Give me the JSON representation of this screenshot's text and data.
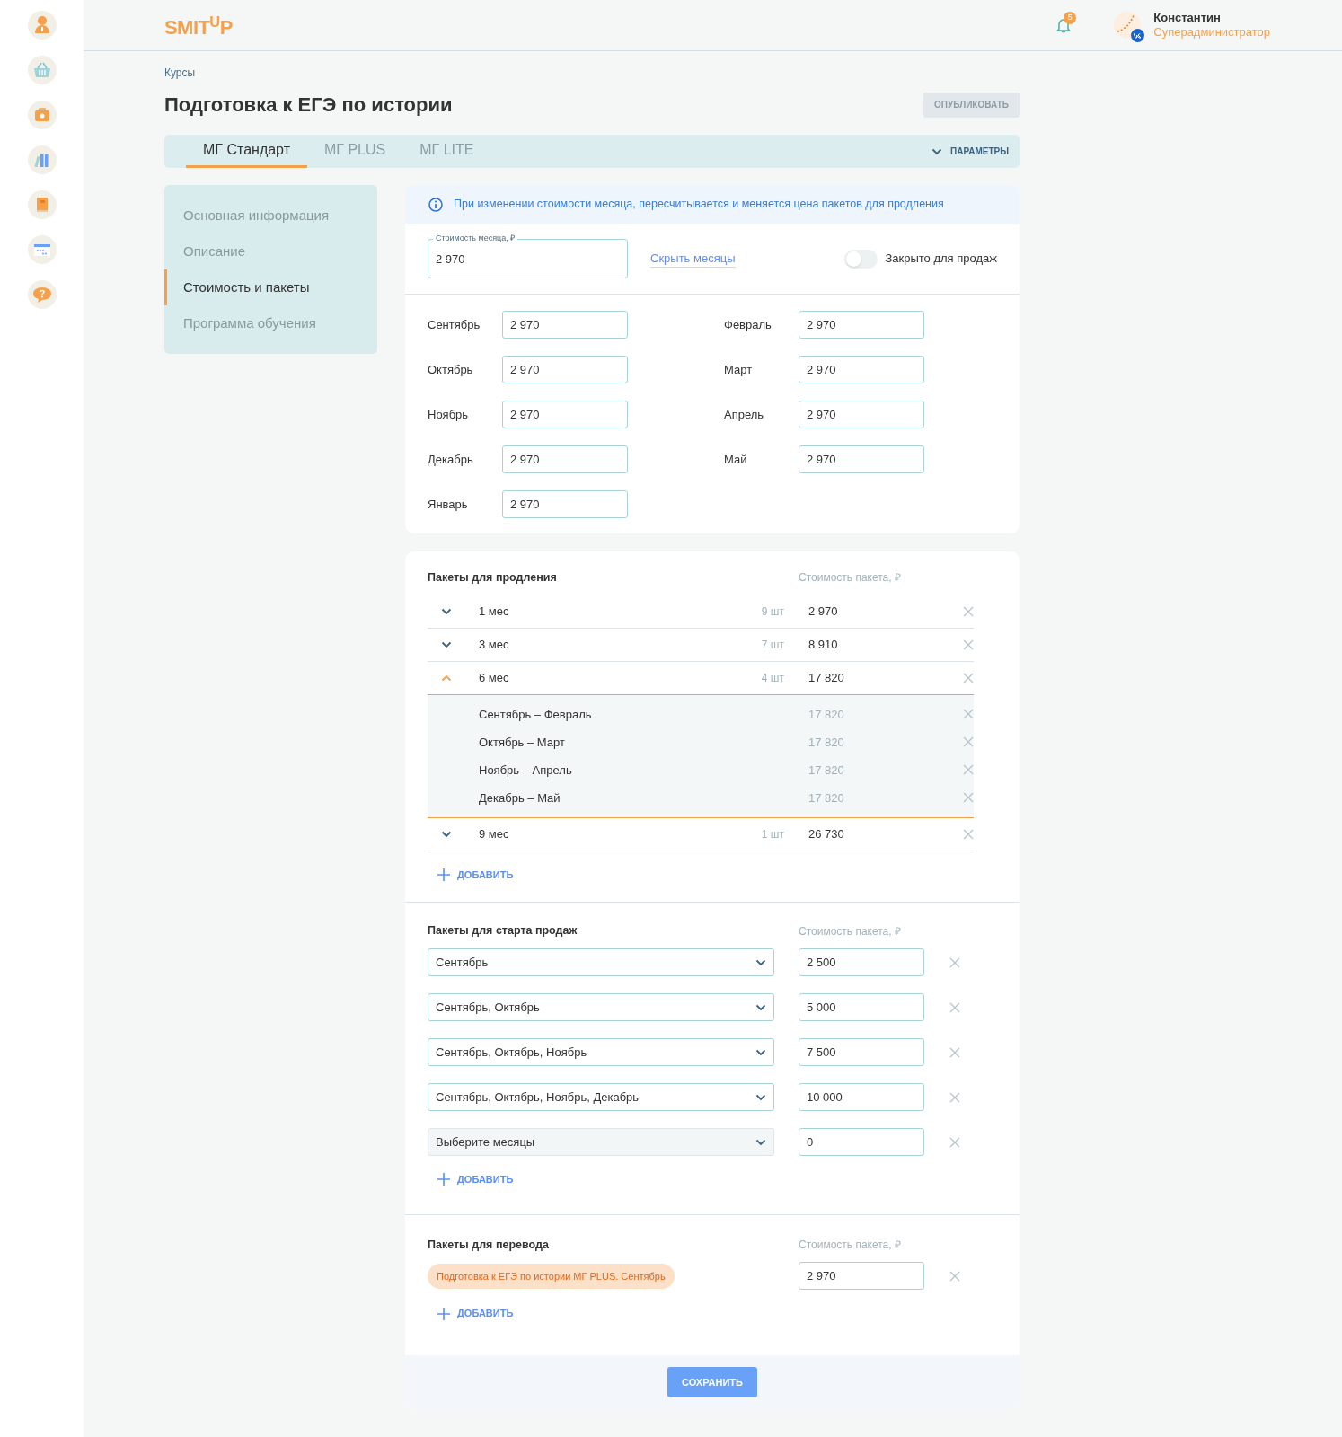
{
  "header": {
    "logo": "SMIT$^{U}$P",
    "notifications": "5",
    "user": {
      "name": "Константин",
      "role": "Суперадминистратор"
    }
  },
  "breadcrumb": "Курсы",
  "title": "Подготовка к ЕГЭ по истории",
  "publish_button": {
    "label": "ОПУБЛИКОВАТЬ",
    "disabled": true
  },
  "tabs": [
    {
      "label": "МГ Стандарт",
      "selected": true
    },
    {
      "label": "МГ PLUS",
      "selected": false
    },
    {
      "label": "МГ LITE",
      "selected": false
    }
  ],
  "params_button": "ПАРАМЕТРЫ",
  "nav": [
    {
      "label": "Основная информация",
      "selected": false
    },
    {
      "label": "Описание",
      "selected": false
    },
    {
      "label": "Стоимость и пакеты",
      "selected": true
    },
    {
      "label": "Программа обучения",
      "selected": false
    }
  ],
  "info": "При изменении стоимости месяца, пересчитывается и меняется цена пакетов для продления",
  "month_cost": {
    "label": "Стоимость месяца, ₽",
    "value": "2 970"
  },
  "hide_months_link": "Скрыть месяцы",
  "closed_toggle": {
    "label": "Закрыто для продаж",
    "on": false
  },
  "months": [
    {
      "label": "Сентябрь",
      "value": "2 970"
    },
    {
      "label": "Октябрь",
      "value": "2 970"
    },
    {
      "label": "Ноябрь",
      "value": "2 970"
    },
    {
      "label": "Декабрь",
      "value": "2 970"
    },
    {
      "label": "Январь",
      "value": "2 970"
    },
    {
      "label": "Февраль",
      "value": "2 970"
    },
    {
      "label": "Март",
      "value": "2 970"
    },
    {
      "label": "Апрель",
      "value": "2 970"
    },
    {
      "label": "Май",
      "value": "2 970"
    }
  ],
  "renewal": {
    "title": "Пакеты для продления",
    "price_header": "Стоимость пакета, ₽",
    "add": "ДОБАВИТЬ",
    "packages": [
      {
        "label": "1 мес",
        "count": "9 шт",
        "price": "2 970",
        "expanded": false
      },
      {
        "label": "3 мес",
        "count": "7 шт",
        "price": "8 910",
        "expanded": false
      },
      {
        "label": "6 мес",
        "count": "4 шт",
        "price": "17 820",
        "expanded": true,
        "children": [
          {
            "label": "Сентябрь – Февраль",
            "price": "17 820"
          },
          {
            "label": "Октябрь – Март",
            "price": "17 820"
          },
          {
            "label": "Ноябрь – Апрель",
            "price": "17 820"
          },
          {
            "label": "Декабрь – Май",
            "price": "17 820"
          }
        ]
      },
      {
        "label": "9 мес",
        "count": "1 шт",
        "price": "26 730",
        "expanded": false
      }
    ]
  },
  "start_sales": {
    "title": "Пакеты для старта продаж",
    "price_header": "Стоимость пакета, ₽",
    "add": "ДОБАВИТЬ",
    "rows": [
      {
        "months": "Сентябрь",
        "price": "2 500"
      },
      {
        "months": "Сентябрь, Октябрь",
        "price": "5 000"
      },
      {
        "months": "Сентябрь, Октябрь, Ноябрь",
        "price": "7 500"
      },
      {
        "months": "Сентябрь, Октябрь, Ноябрь, Декабрь",
        "price": "10 000"
      },
      {
        "placeholder": "Выберите месяцы",
        "price": "0"
      }
    ]
  },
  "transfer": {
    "title": "Пакеты для перевода",
    "price_header": "Стоимость пакета, ₽",
    "add": "ДОБАВИТЬ",
    "rows": [
      {
        "tag": "Подготовка к ЕГЭ по истории МГ PLUS. Сентябрь",
        "price": "2 970"
      }
    ]
  },
  "save_button": "СОХРАНИТЬ"
}
